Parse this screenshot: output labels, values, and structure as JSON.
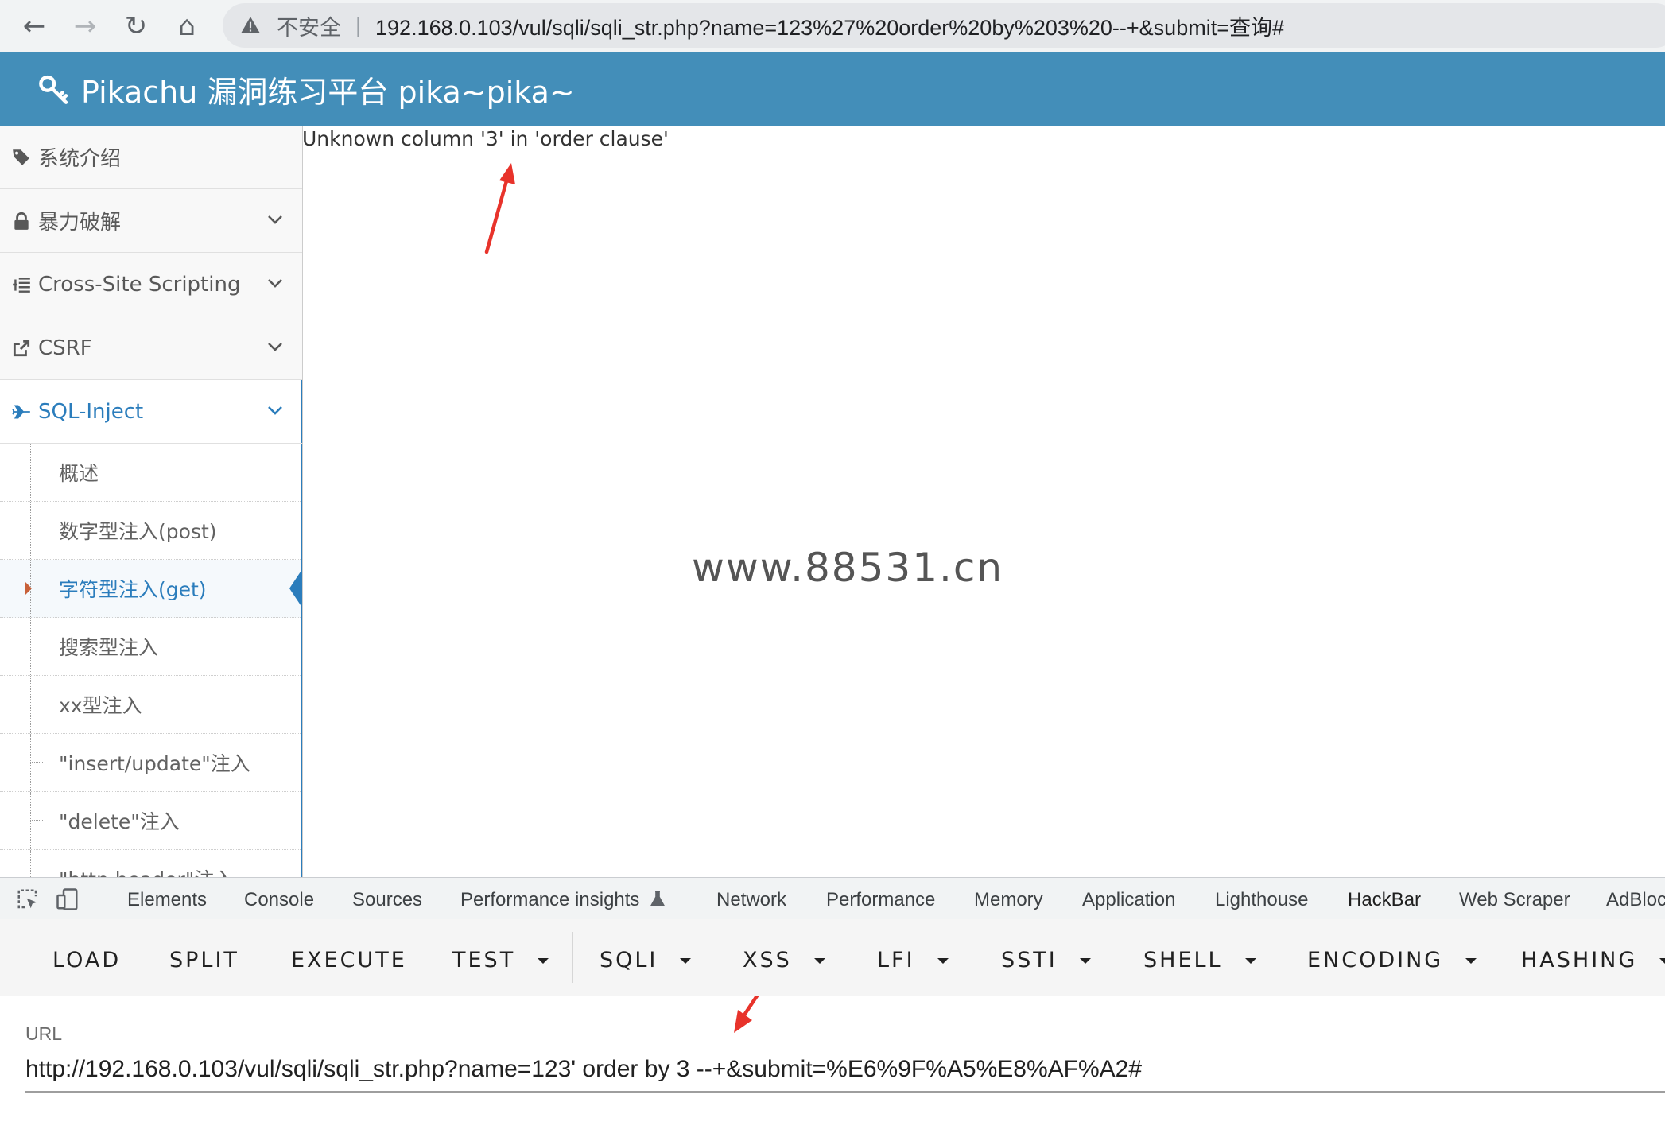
{
  "browser": {
    "back_label": "←",
    "forward_label": "→",
    "reload_label": "↻",
    "home_label": "⌂",
    "security_text": "不安全",
    "separator": "|",
    "address": "192.168.0.103/vul/sqli/sqli_str.php?name=123%27%20order%20by%203%20--+&submit=查询#"
  },
  "header": {
    "title": "Pikachu 漏洞练习平台 pika~pika~",
    "icon": "key-icon"
  },
  "sidebar": {
    "items": [
      {
        "label": "系统介绍",
        "icon": "tags-icon"
      },
      {
        "label": "暴力破解",
        "icon": "lock-icon"
      },
      {
        "label": "Cross-Site Scripting",
        "icon": "list-icon"
      },
      {
        "label": "CSRF",
        "icon": "share-icon"
      },
      {
        "label": "SQL-Inject",
        "icon": "plane-icon"
      }
    ],
    "subitems": [
      {
        "label": "概述"
      },
      {
        "label": "数字型注入(post)"
      },
      {
        "label": "字符型注入(get)"
      },
      {
        "label": "搜索型注入"
      },
      {
        "label": "xx型注入"
      },
      {
        "label": "\"insert/update\"注入"
      },
      {
        "label": "\"delete\"注入"
      },
      {
        "label": "\"http header\"注入"
      }
    ]
  },
  "main": {
    "error": "Unknown column '3' in 'order clause'",
    "watermark": "www.88531.cn"
  },
  "devtools": {
    "tabs": [
      "Elements",
      "Console",
      "Sources",
      "Performance insights",
      "Network",
      "Performance",
      "Memory",
      "Application",
      "Lighthouse",
      "HackBar",
      "Web Scraper",
      "AdBlock"
    ],
    "active_tab": "HackBar"
  },
  "hackbar": {
    "buttons": [
      "LOAD",
      "SPLIT",
      "EXECUTE",
      "TEST",
      "SQLI",
      "XSS",
      "LFI",
      "SSTI",
      "SHELL",
      "ENCODING",
      "HASHING"
    ],
    "url_label": "URL",
    "url_value": "http://192.168.0.103/vul/sqli/sqli_str.php?name=123' order by 3 --+&submit=%E6%9F%A5%E8%AF%A2#"
  },
  "colors": {
    "header_bg": "#438eb9",
    "active_blue": "#2b7dbc",
    "arrow_red": "#e8332b"
  }
}
